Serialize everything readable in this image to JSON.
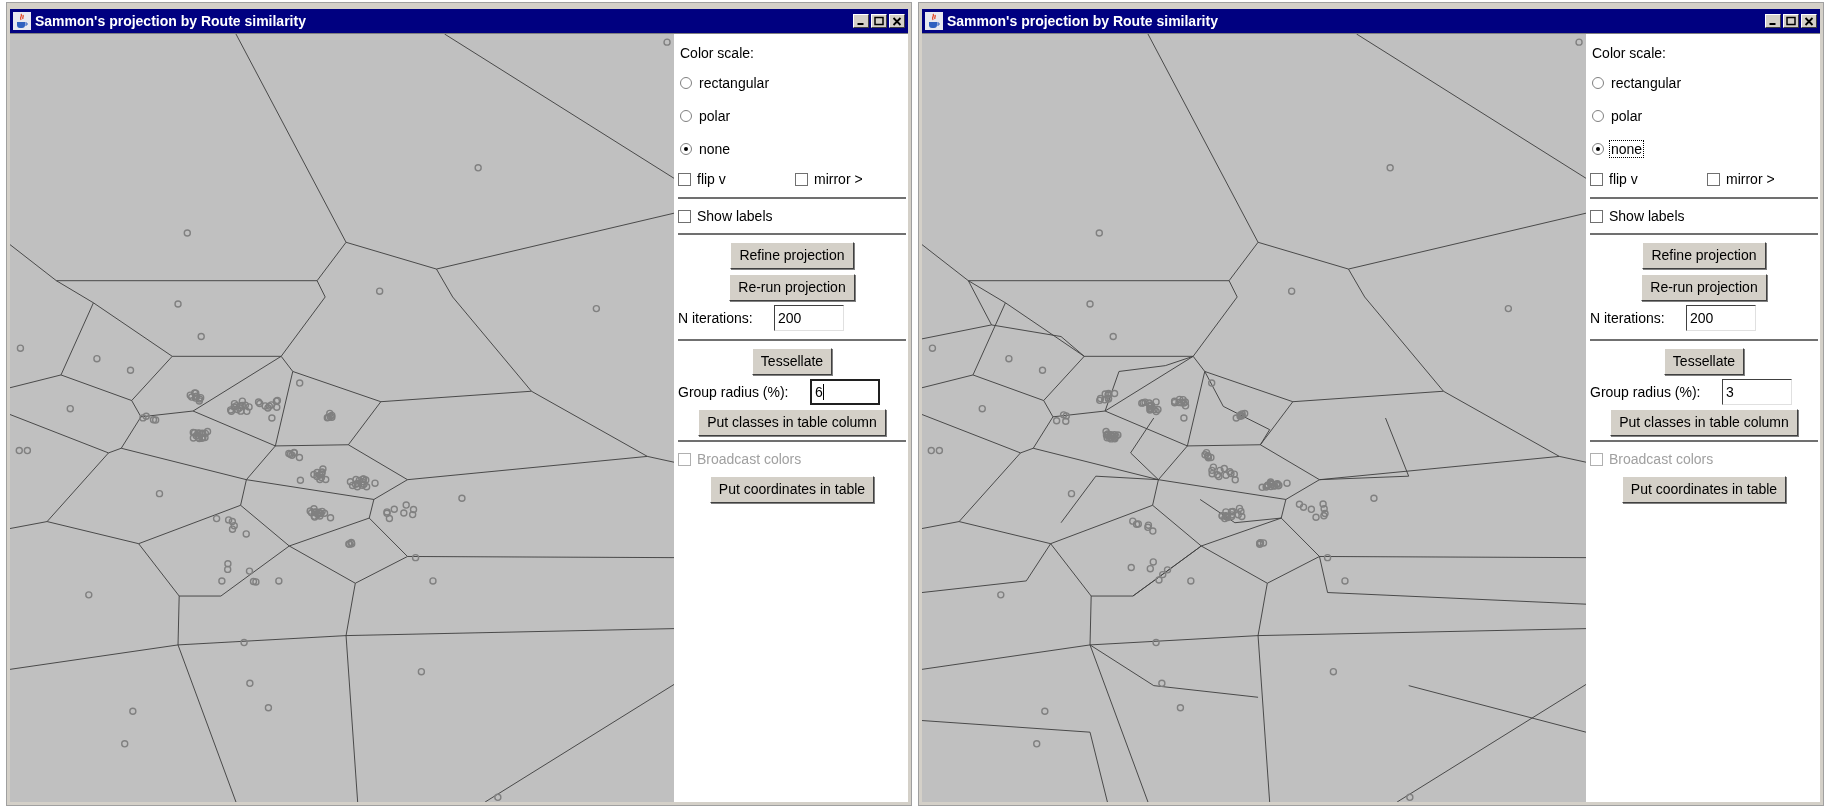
{
  "windows": [
    {
      "title": "Sammon's projection by Route similarity",
      "controls": {
        "color_scale": {
          "label": "Color scale:",
          "options": [
            {
              "label": "rectangular",
              "selected": false,
              "focused": false
            },
            {
              "label": "polar",
              "selected": false,
              "focused": false
            },
            {
              "label": "none",
              "selected": true,
              "focused": false
            }
          ]
        },
        "flip_v": {
          "label": "flip v",
          "checked": false
        },
        "mirror": {
          "label": "mirror >",
          "checked": false
        },
        "show_labels": {
          "label": "Show labels",
          "checked": false
        },
        "refine_button": "Refine projection",
        "rerun_button": "Re-run projection",
        "iterations": {
          "label": "N iterations:",
          "value": "200"
        },
        "tessellate_button": "Tessellate",
        "group_radius": {
          "label": "Group radius (%):",
          "value": "6",
          "focused": true
        },
        "classes_button": "Put classes in table column",
        "broadcast": {
          "label": "Broadcast colors",
          "checked": false,
          "disabled": true
        },
        "coordinates_button": "Put coordinates in table"
      }
    },
    {
      "title": "Sammon's projection by Route similarity",
      "controls": {
        "color_scale": {
          "label": "Color scale:",
          "options": [
            {
              "label": "rectangular",
              "selected": false,
              "focused": false
            },
            {
              "label": "polar",
              "selected": false,
              "focused": false
            },
            {
              "label": "none",
              "selected": true,
              "focused": true
            }
          ]
        },
        "flip_v": {
          "label": "flip v",
          "checked": false
        },
        "mirror": {
          "label": "mirror >",
          "checked": false
        },
        "show_labels": {
          "label": "Show labels",
          "checked": false
        },
        "refine_button": "Refine projection",
        "rerun_button": "Re-run projection",
        "iterations": {
          "label": "N iterations:",
          "value": "200"
        },
        "tessellate_button": "Tessellate",
        "group_radius": {
          "label": "Group radius (%):",
          "value": "3",
          "focused": false
        },
        "classes_button": "Put classes in table column",
        "broadcast": {
          "label": "Broadcast colors",
          "checked": false,
          "disabled": true
        },
        "coordinates_button": "Put coordinates in table"
      }
    }
  ]
}
